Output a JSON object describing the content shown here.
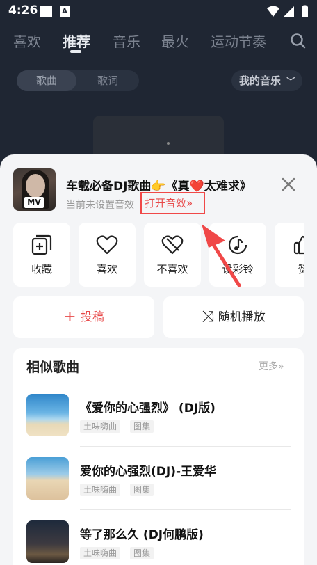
{
  "status_bar": {
    "time": "4:26",
    "notification_a": "A"
  },
  "nav": {
    "tabs": [
      "喜欢",
      "推荐",
      "音乐",
      "最火",
      "运动节奏"
    ],
    "active_tab": "推荐"
  },
  "segment": {
    "items": [
      "歌曲",
      "歌词"
    ],
    "active": "歌曲"
  },
  "my_music": "我的音乐",
  "current_song": {
    "badge": "MV",
    "title": "车载必备DJ歌曲👉《真❤️太难求》",
    "sound_status": "当前未设置音效",
    "sound_link": "打开音效»"
  },
  "actions": [
    {
      "label": "收藏",
      "icon": "collect-icon"
    },
    {
      "label": "喜欢",
      "icon": "heart-icon"
    },
    {
      "label": "不喜欢",
      "icon": "broken-heart-icon"
    },
    {
      "label": "设彩铃",
      "icon": "ringtone-icon"
    },
    {
      "label": "赞",
      "icon": "thumbs-up-icon"
    }
  ],
  "buttons": {
    "submit": {
      "glyph": "+",
      "label": "投稿"
    },
    "shuffle": {
      "glyph": "⤨",
      "label": "随机播放"
    }
  },
  "similar": {
    "title": "相似歌曲",
    "more": "更多»",
    "tracks": [
      {
        "title": "《爱你的心强烈》 (DJ版)",
        "tags": [
          "土味嗨曲",
          "图集"
        ]
      },
      {
        "title": "爱你的心强烈(DJ)-王爱华",
        "tags": [
          "土味嗨曲",
          "图集"
        ]
      },
      {
        "title": "等了那么久 (DJ何鹏版)",
        "tags": [
          "土味嗨曲",
          "图集"
        ]
      }
    ]
  },
  "colors": {
    "accent_red": "#e84a4a",
    "highlight_box": "#f04848",
    "sheet_bg": "#f4f5f7",
    "backdrop": "#1f2633"
  }
}
